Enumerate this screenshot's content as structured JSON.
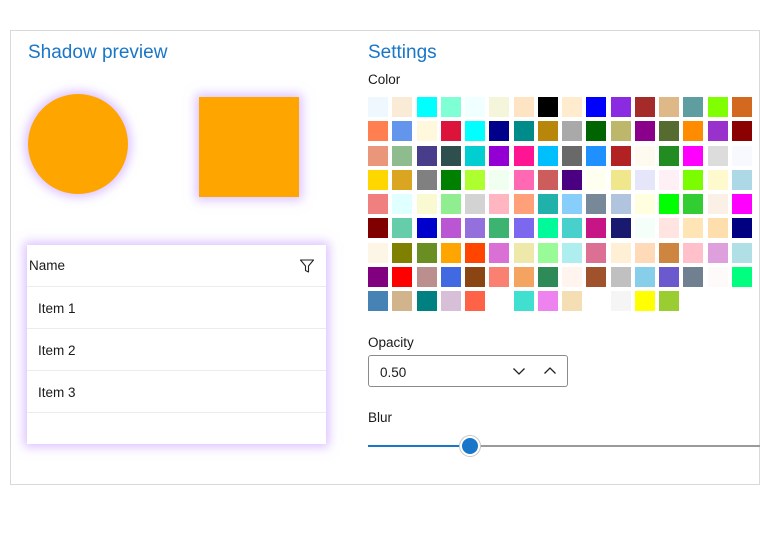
{
  "preview": {
    "title": "Shadow preview",
    "shape_color": "#FFA500",
    "shadow_color": "#BF8CFF",
    "list": {
      "header": "Name",
      "items": [
        "Item 1",
        "Item 2",
        "Item 3"
      ]
    }
  },
  "settings": {
    "title": "Settings",
    "color_label": "Color",
    "colors": [
      [
        "#F0F8FF",
        "#FAEBD7",
        "#00FFFF",
        "#7FFFD4",
        "#F0FFFF",
        "#F5F5DC",
        "#FFE4C4",
        "#000000",
        "#FFEBCD",
        "#0000FF",
        "#8A2BE2",
        "#A52A2A",
        "#DEB887",
        "#5F9EA0",
        "#7FFF00",
        "#D2691E"
      ],
      [
        "#FF7F50",
        "#6495ED",
        "#FFF8DC",
        "#DC143C",
        "#00FFFF",
        "#00008B",
        "#008B8B",
        "#B8860B",
        "#A9A9A9",
        "#006400",
        "#BDB76B",
        "#8B008B",
        "#556B2F",
        "#FF8C00",
        "#9932CC",
        "#8B0000"
      ],
      [
        "#E9967A",
        "#8FBC8F",
        "#483D8B",
        "#2F4F4F",
        "#00CED1",
        "#9400D3",
        "#FF1493",
        "#00BFFF",
        "#696969",
        "#1E90FF",
        "#B22222",
        "#FFFAF0",
        "#228B22",
        "#FF00FF",
        "#DCDCDC",
        "#F8F8FF"
      ],
      [
        "#FFD700",
        "#DAA520",
        "#808080",
        "#008000",
        "#ADFF2F",
        "#F0FFF0",
        "#FF69B4",
        "#CD5C5C",
        "#4B0082",
        "#FFFFF0",
        "#F0E68C",
        "#E6E6FA",
        "#FFF0F5",
        "#7CFC00",
        "#FFFACD",
        "#ADD8E6"
      ],
      [
        "#F08080",
        "#E0FFFF",
        "#FAFAD2",
        "#90EE90",
        "#D3D3D3",
        "#FFB6C1",
        "#FFA07A",
        "#20B2AA",
        "#87CEFA",
        "#778899",
        "#B0C4DE",
        "#FFFFE0",
        "#00FF00",
        "#32CD32",
        "#FAF0E6",
        "#FF00FF"
      ],
      [
        "#800000",
        "#66CDAA",
        "#0000CD",
        "#BA55D3",
        "#9370DB",
        "#3CB371",
        "#7B68EE",
        "#00FA9A",
        "#48D1CC",
        "#C71585",
        "#191970",
        "#F5FFFA",
        "#FFE4E1",
        "#FFE4B5",
        "#FFDEAD",
        "#000080"
      ],
      [
        "#FDF5E6",
        "#808000",
        "#6B8E23",
        "#FFA500",
        "#FF4500",
        "#DA70D6",
        "#EEE8AA",
        "#98FB98",
        "#AFEEEE",
        "#DB7093",
        "#FFEFD5",
        "#FFDAB9",
        "#CD853F",
        "#FFC0CB",
        "#DDA0DD",
        "#B0E0E6"
      ],
      [
        "#800080",
        "#FF0000",
        "#BC8F8F",
        "#4169E1",
        "#8B4513",
        "#FA8072",
        "#F4A460",
        "#2E8B57",
        "#FFF5EE",
        "#A0522D",
        "#C0C0C0",
        "#87CEEB",
        "#6A5ACD",
        "#708090",
        "#FFFAFA",
        "#00FF7F"
      ],
      [
        "#4682B4",
        "#D2B48C",
        "#008080",
        "#D8BFD8",
        "#FF6347",
        "#FFFFFF",
        "#40E0D0",
        "#EE82EE",
        "#F5DEB3",
        "#FFFFFF",
        "#F5F5F5",
        "#FFFF00",
        "#9ACD32"
      ]
    ],
    "opacity": {
      "label": "Opacity",
      "value": "0.50"
    },
    "blur": {
      "label": "Blur",
      "fraction": 0.247
    }
  }
}
